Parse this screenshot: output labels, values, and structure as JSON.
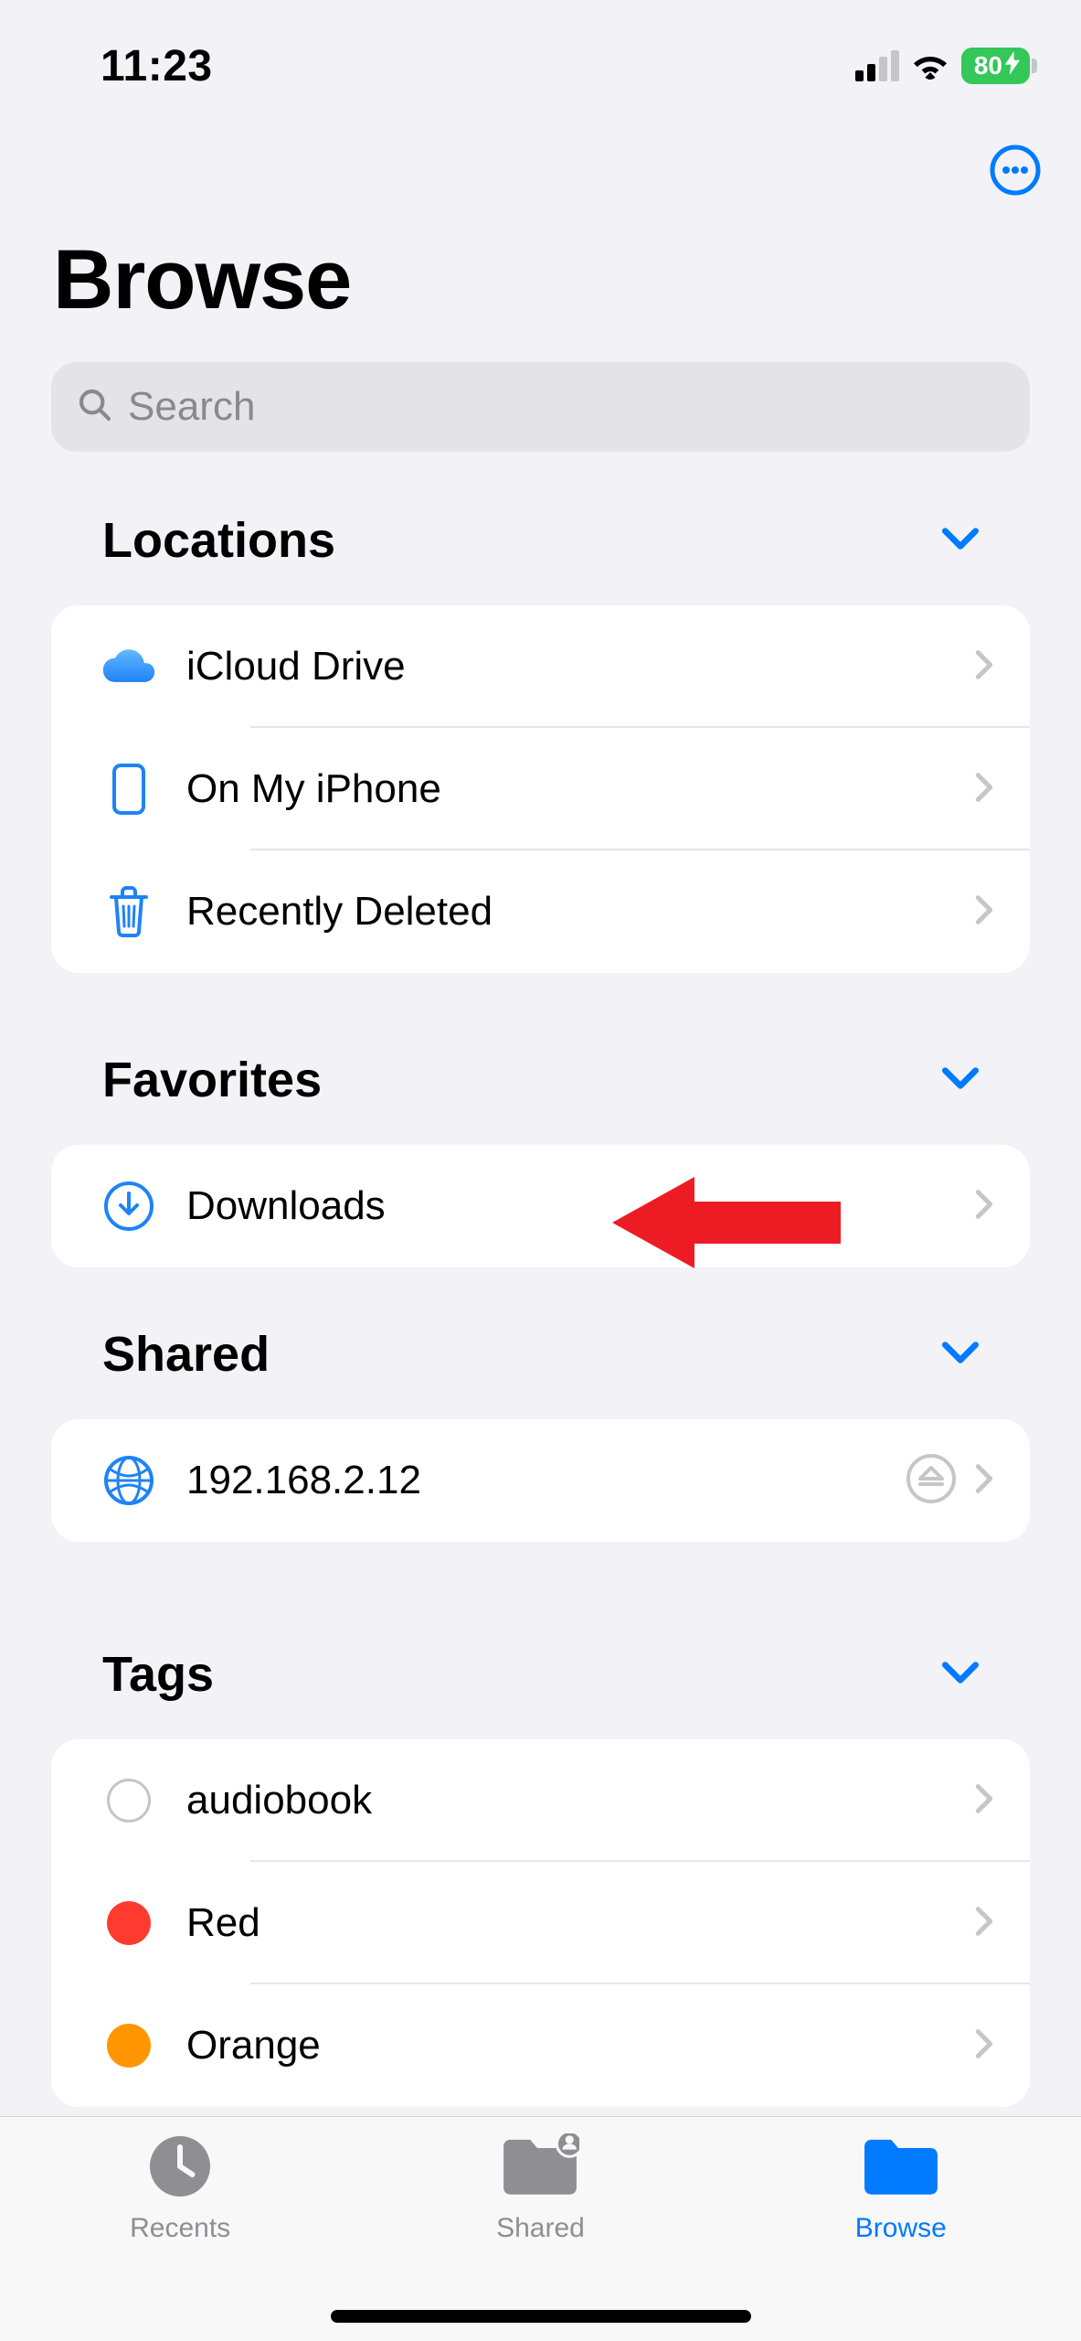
{
  "status": {
    "time": "11:23",
    "signal_active_bars": 2,
    "battery_percent": "80"
  },
  "page": {
    "title": "Browse",
    "search_placeholder": "Search"
  },
  "sections": {
    "locations": {
      "title": "Locations",
      "items": [
        {
          "label": "iCloud Drive"
        },
        {
          "label": "On My iPhone"
        },
        {
          "label": "Recently Deleted"
        }
      ]
    },
    "favorites": {
      "title": "Favorites",
      "items": [
        {
          "label": "Downloads"
        }
      ]
    },
    "shared": {
      "title": "Shared",
      "items": [
        {
          "label": "192.168.2.12"
        }
      ]
    },
    "tags": {
      "title": "Tags",
      "items": [
        {
          "label": "audiobook",
          "color": "#ffffff",
          "stroke": "#c6c6c9"
        },
        {
          "label": "Red",
          "color": "#ff3b30"
        },
        {
          "label": "Orange",
          "color": "#ff9500"
        }
      ]
    }
  },
  "tabs": {
    "recents": "Recents",
    "shared": "Shared",
    "browse": "Browse"
  }
}
